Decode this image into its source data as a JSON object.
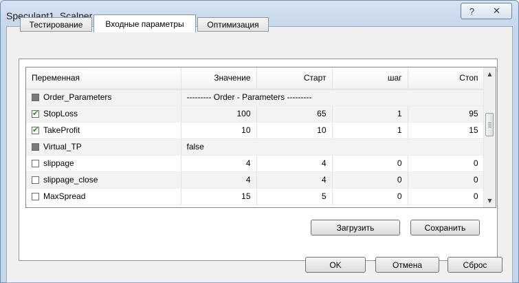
{
  "window": {
    "title": "Speculant1_Scalper",
    "help_glyph": "?",
    "close_glyph": "✕"
  },
  "tabs": [
    {
      "label": "Тестирование"
    },
    {
      "label": "Входные параметры",
      "active": true
    },
    {
      "label": "Оптимизация"
    }
  ],
  "grid": {
    "columns": [
      "Переменная",
      "Значение",
      "Старт",
      "шаг",
      "Стоп"
    ],
    "rows": [
      {
        "name": "Order_Parameters",
        "checkbox": "grey",
        "value": "--------- Order - Parameters ---------",
        "start": "",
        "step": "",
        "stop": ""
      },
      {
        "name": "StopLoss",
        "checkbox": "checked",
        "value": "100",
        "start": "65",
        "step": "1",
        "stop": "95"
      },
      {
        "name": "TakeProfit",
        "checkbox": "checked",
        "value": "10",
        "start": "10",
        "step": "1",
        "stop": "15"
      },
      {
        "name": "Virtual_TP",
        "checkbox": "grey",
        "value": "false",
        "start": "",
        "step": "",
        "stop": ""
      },
      {
        "name": "slippage",
        "checkbox": "unchecked",
        "value": "4",
        "start": "4",
        "step": "0",
        "stop": "0"
      },
      {
        "name": "slippage_close",
        "checkbox": "unchecked",
        "value": "4",
        "start": "4",
        "step": "0",
        "stop": "0"
      },
      {
        "name": "MaxSpread",
        "checkbox": "unchecked",
        "value": "15",
        "start": "5",
        "step": "0",
        "stop": "0"
      }
    ],
    "scroll_up": "▲",
    "scroll_down": "▼"
  },
  "panel_buttons": {
    "load": "Загрузить",
    "save": "Сохранить"
  },
  "dialog_buttons": {
    "ok": "OK",
    "cancel": "Отмена",
    "reset": "Сброс"
  }
}
